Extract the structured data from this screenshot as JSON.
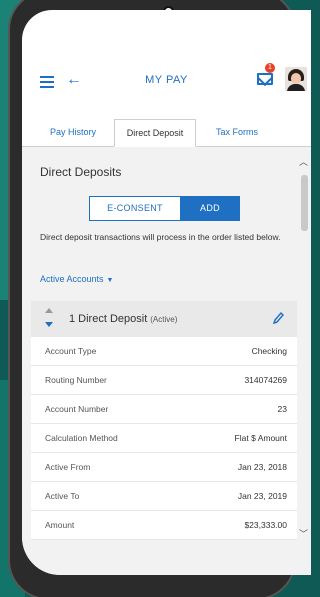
{
  "header": {
    "title": "MY PAY",
    "notification_count": "1"
  },
  "tabs": [
    {
      "label": "Pay History"
    },
    {
      "label": "Direct Deposit"
    },
    {
      "label": "Tax Forms"
    }
  ],
  "main": {
    "section_title": "Direct Deposits",
    "econsent_label": "E-CONSENT",
    "add_label": "ADD",
    "info_text": "Direct deposit transactions will process in the order listed below.",
    "filter_label": "Active Accounts"
  },
  "deposit": {
    "title": "1 Direct Deposit",
    "status": "(Active)",
    "rows": [
      {
        "label": "Account Type",
        "value": "Checking"
      },
      {
        "label": "Routing Number",
        "value": "314074269"
      },
      {
        "label": "Account Number",
        "value": "23"
      },
      {
        "label": "Calculation Method",
        "value": "Flat $ Amount"
      },
      {
        "label": "Active From",
        "value": "Jan 23, 2018"
      },
      {
        "label": "Active To",
        "value": "Jan 23, 2019"
      },
      {
        "label": "Amount",
        "value": "$23,333.00"
      }
    ]
  },
  "colors": {
    "accent": "#1f6fc2",
    "background": "#0f5a55",
    "badge": "#e8432a"
  }
}
